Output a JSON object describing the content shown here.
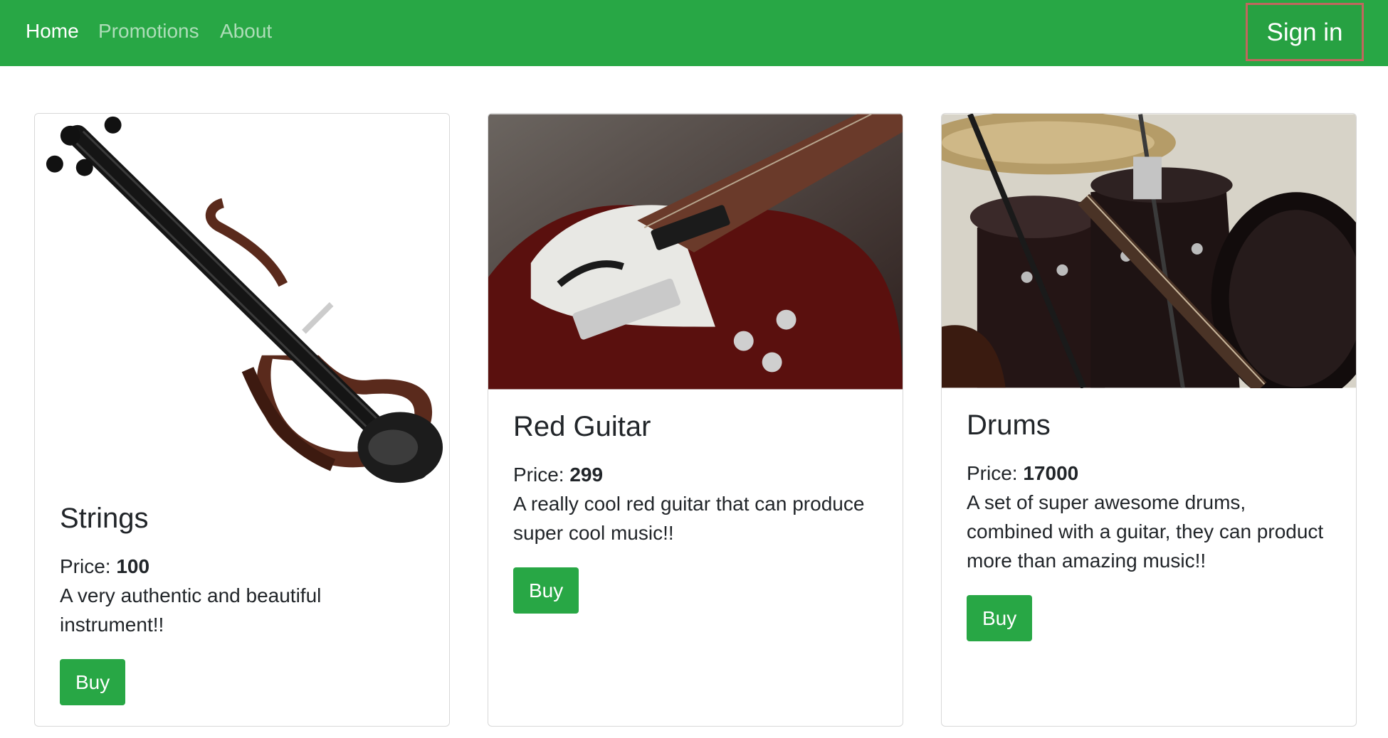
{
  "navbar": {
    "links": [
      "Home",
      "Promotions",
      "About"
    ],
    "active": "Home",
    "signin_label": "Sign in"
  },
  "products": [
    {
      "title": "Strings",
      "price_label": "Price:",
      "price": "100",
      "description": "A very authentic and beautiful instrument!!",
      "button": "Buy"
    },
    {
      "title": "Red Guitar",
      "price_label": "Price:",
      "price": "299",
      "description": "A really cool red guitar that can produce super cool music!!",
      "button": "Buy"
    },
    {
      "title": "Drums",
      "price_label": "Price:",
      "price": "17000",
      "description": "A set of super awesome drums, combined with a guitar, they can product more than amazing music!!",
      "button": "Buy"
    }
  ],
  "colors": {
    "brand": "#28a745",
    "signin_border": "#c0675d"
  }
}
